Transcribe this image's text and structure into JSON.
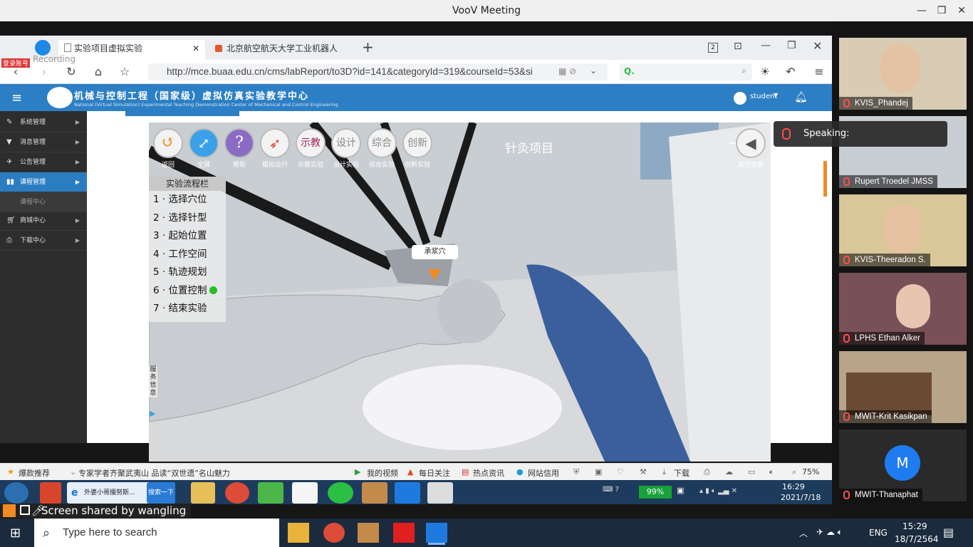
{
  "voov": {
    "title": "VooV Meeting",
    "share_notice": "Screen shared by wangling",
    "speaking_label": "Speaking:",
    "participants": [
      {
        "name": "KVIS_Phandej",
        "bg": "#d8cdb4",
        "avatar": ""
      },
      {
        "name": "Rupert Troedel JMSS",
        "bg": "#c7cdd2",
        "avatar": ""
      },
      {
        "name": "KVIS-Theeradon S.",
        "bg": "#d9c79a",
        "avatar": ""
      },
      {
        "name": "LPHS Ethan Alker",
        "bg": "#7a5058",
        "avatar": ""
      },
      {
        "name": "MWIT-Krit Kasikpan",
        "bg": "#b8a488",
        "avatar": ""
      },
      {
        "name": "MWIT-Thanaphat",
        "bg": "#2a2a2a",
        "avatar": "M"
      }
    ]
  },
  "recording": {
    "label": "Recording",
    "badge": "登录账号"
  },
  "browser": {
    "tabs": [
      {
        "label": "实验项目虚拟实验",
        "active": true
      },
      {
        "label": "北京航空航天大学工业机器人",
        "active": false
      }
    ],
    "tab_count": "2",
    "new_tab": "+",
    "url": "http://mce.buaa.edu.cn/cms/labReport/to3D?id=141&categoryId=319&courseId=53&si",
    "search_placeholder": "Q.",
    "zoom": "75%"
  },
  "site": {
    "title": "机械与控制工程（国家级）虚拟仿真实验教学中心",
    "subtitle": "National (Virtual Simulation) Experimental Teaching Demonstration Center of Mechanical and Control Engineering",
    "user": "student",
    "sidebar": [
      {
        "label": "系统管理",
        "icon": "wrench-icon",
        "active": false
      },
      {
        "label": "消息管理",
        "icon": "filter-icon",
        "active": false
      },
      {
        "label": "公告管理",
        "icon": "plane-icon",
        "active": false
      },
      {
        "label": "课程管理",
        "icon": "book-icon",
        "active": true
      },
      {
        "label": "课程中心",
        "icon": "",
        "active": false
      },
      {
        "label": "商城中心",
        "icon": "cart-icon",
        "active": false
      },
      {
        "label": "下载中心",
        "icon": "print-icon",
        "active": false
      }
    ]
  },
  "sim": {
    "project_title": "针灸项目",
    "toolbar": [
      {
        "label": "返回",
        "glyph": "↺"
      },
      {
        "label": "全屏",
        "glyph": "⤢"
      },
      {
        "label": "帮助",
        "glyph": "?"
      },
      {
        "label": "模拟运行",
        "glyph": "➶"
      },
      {
        "label": "示教实验",
        "glyph": "示教"
      },
      {
        "label": "设计实验",
        "glyph": "设计"
      },
      {
        "label": "综合实验",
        "glyph": "综合"
      },
      {
        "label": "创新实验",
        "glyph": "创新"
      }
    ],
    "props_label": "属性面板",
    "steps_header": "实验流程栏",
    "steps": [
      "1 · 选择穴位",
      "2 · 选择针型",
      "3 · 起始位置",
      "4 · 工作空间",
      "5 · 轨迹规划",
      "6 · 位置控制",
      "7 · 结束实验"
    ],
    "active_step_index": 6,
    "acupoint_label": "承浆穴",
    "service_label": "服务信息"
  },
  "statusbar": {
    "left": "爆款推荐",
    "news": "专家学者齐聚武夷山 品读“双世遗”名山魅力",
    "items": [
      "我的视频",
      "每日关注",
      "热点资讯",
      "网站信用",
      "下载"
    ]
  },
  "inner_taskbar": {
    "ie_label": "外婆小哥擂努斯...",
    "search_btn": "搜索一下",
    "battery": "99%",
    "time": "16:29",
    "date": "2021/7/18"
  },
  "windows_taskbar": {
    "search_placeholder": "Type here to search",
    "lang": "ENG",
    "time": "15:29",
    "date": "18/7/2564"
  }
}
